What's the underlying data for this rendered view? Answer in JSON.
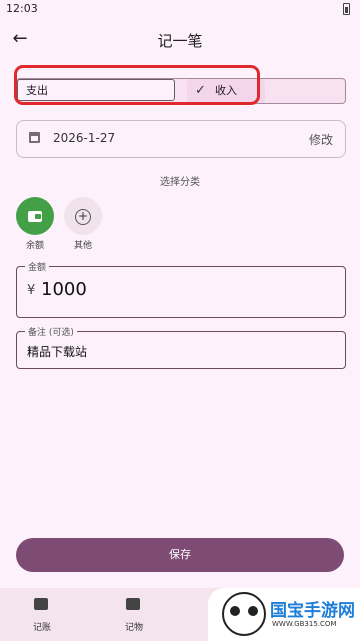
{
  "status_bar": {
    "time": "12:03"
  },
  "header": {
    "title": "记一笔",
    "back_icon": "back-arrow-icon"
  },
  "type_toggle": {
    "expense_label": "支出",
    "income_label": "收入",
    "selected": "收入",
    "selected_icon": "check-icon"
  },
  "date": {
    "icon": "calendar-icon",
    "value": "2026-1-27",
    "action": "修改"
  },
  "category": {
    "title": "选择分类",
    "items": [
      {
        "label": "余额",
        "icon": "wallet-icon"
      },
      {
        "label": "其他",
        "icon": "add-circle-icon"
      }
    ]
  },
  "amount": {
    "label": "金额",
    "currency": "¥",
    "value": "1000"
  },
  "notes": {
    "label": "备注 (可选)",
    "value": "精品下载站"
  },
  "save_button": {
    "label": "保存"
  },
  "bottom_nav": [
    {
      "label": "记账",
      "icon": "wallet-icon"
    },
    {
      "label": "记物",
      "icon": "archive-icon"
    }
  ],
  "watermark": {
    "title": "国宝手游网",
    "url": "WWW.GB315.COM"
  },
  "colors": {
    "background": "#fdf1fb",
    "primary": "#7d4b74",
    "green": "#43a047",
    "highlight": "#e0282d"
  }
}
